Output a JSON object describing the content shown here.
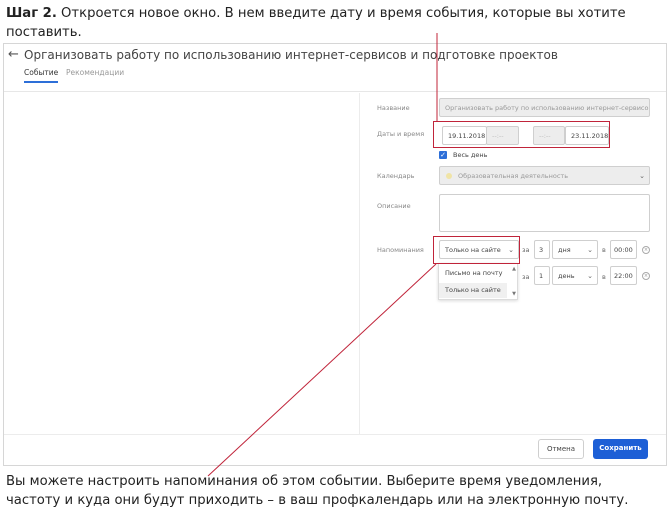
{
  "instructions": {
    "step_label": "Шаг 2.",
    "step_text": " Откроется новое окно. В нем введите дату и время события, которые вы хотите поставить.",
    "bottom_text": "Вы можете настроить напоминания об этом событии. Выберите время уведомления, частоту и куда они будут приходить – в ваш профкалендарь или на электронную почту."
  },
  "header": {
    "back_icon": "←",
    "title": "Организовать работу по использованию интернет-сервисов и подготовке проектов",
    "tabs": [
      "Событие",
      "Рекомендации"
    ]
  },
  "form": {
    "name_label": "Название",
    "name_value": "Организовать работу по использованию интернет-сервисов и",
    "date_label": "Даты и время",
    "start_date": "19.11.2018",
    "start_time_placeholder": "--:--",
    "end_time_placeholder": "--:--",
    "end_date": "23.11.2018",
    "all_day_label": "Весь день",
    "calendar_label": "Календарь",
    "calendar_value": "Образовательная деятельность",
    "description_label": "Описание",
    "reminders_label": "Напоминания",
    "reminders": [
      {
        "channel": "Только на сайте",
        "prefix": "за",
        "amount": "3",
        "unit": "дня",
        "at": "в",
        "time": "00:00"
      },
      {
        "prefix": "за",
        "amount": "1",
        "unit": "день",
        "at": "в",
        "time": "22:00"
      }
    ],
    "dropdown_options": [
      "Письмо на почту",
      "Только на сайте"
    ]
  },
  "footer": {
    "cancel_label": "Отмена",
    "save_label": "Сохранить"
  },
  "colors": {
    "accent": "#1d5fd6",
    "highlight": "#c0243a"
  }
}
